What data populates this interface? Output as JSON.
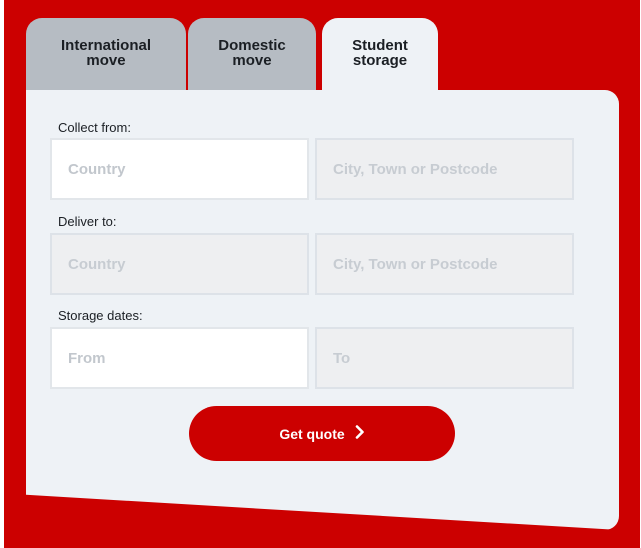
{
  "tabs": [
    {
      "label": "International\nmove",
      "active": false
    },
    {
      "label": "Domestic\nmove",
      "active": false
    },
    {
      "label": "Student\nstorage",
      "active": true
    }
  ],
  "form": {
    "collect_label": "Collect from:",
    "collect_country_placeholder": "Country",
    "collect_city_placeholder": "City, Town or Postcode",
    "deliver_label": "Deliver to:",
    "deliver_country_placeholder": "Country",
    "deliver_city_placeholder": "City, Town or Postcode",
    "dates_label": "Storage dates:",
    "from_placeholder": "From",
    "to_placeholder": "To",
    "submit_label": "Get quote",
    "submit_icon": "chevron-right-icon"
  },
  "colors": {
    "brand_red": "#cc0000",
    "panel_bg": "#eef2f6",
    "inactive_tab": "#b6bcc3"
  }
}
